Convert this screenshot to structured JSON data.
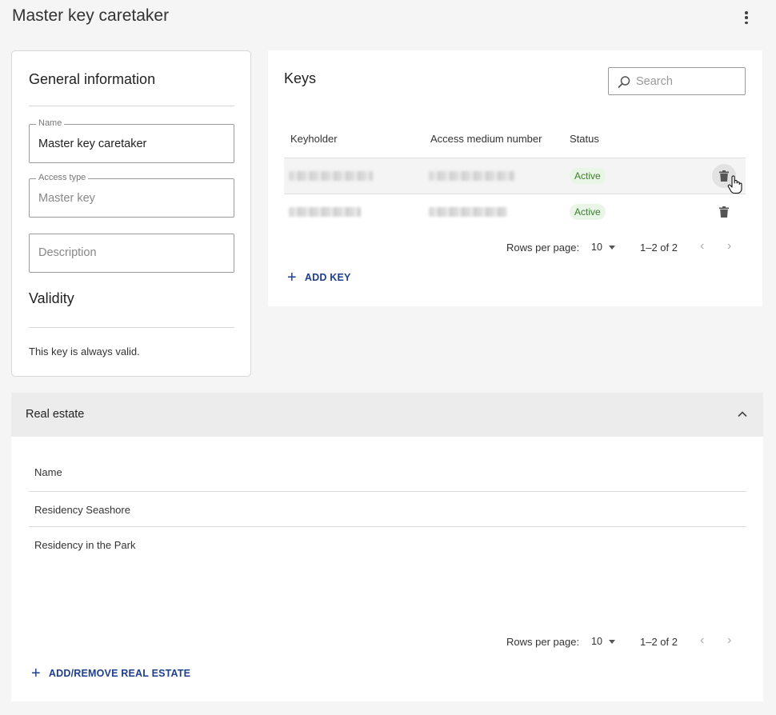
{
  "header": {
    "title": "Master key caretaker",
    "menu_icon": "more-vert-icon"
  },
  "general": {
    "title": "General information",
    "name_label": "Name",
    "name_value": "Master key caretaker",
    "access_type_label": "Access type",
    "access_type_value": "Master key",
    "description_placeholder": "Description",
    "validity_title": "Validity",
    "validity_text": "This key is always valid."
  },
  "keys": {
    "title": "Keys",
    "search_placeholder": "Search",
    "columns": [
      "Keyholder",
      "Access medium number",
      "Status"
    ],
    "rows": [
      {
        "status": "Active"
      },
      {
        "status": "Active"
      }
    ],
    "rows_per_page_label": "Rows per page:",
    "rows_per_page_value": "10",
    "range": "1–2 of 2",
    "add_label": "ADD KEY"
  },
  "real_estate": {
    "title": "Real estate",
    "column": "Name",
    "rows": [
      "Residency Seashore",
      "Residency in the Park"
    ],
    "rows_per_page_label": "Rows per page:",
    "rows_per_page_value": "10",
    "range": "1–2 of 2",
    "add_label": "ADD/REMOVE REAL ESTATE"
  },
  "colors": {
    "accent": "#1f3f8a",
    "status_active_bg": "#e9f5e7",
    "status_active_text": "#3b7d2b"
  }
}
